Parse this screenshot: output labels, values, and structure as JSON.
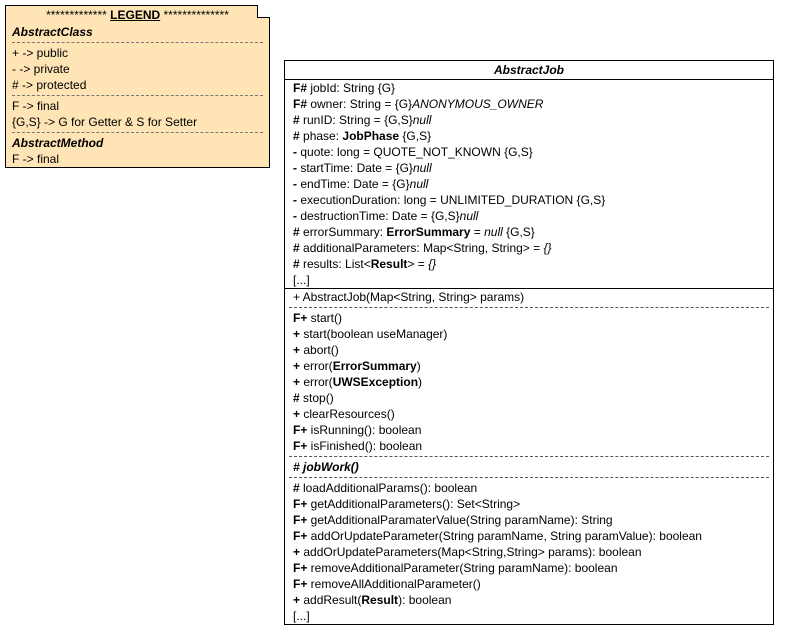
{
  "legend": {
    "title_left_stars": "*************",
    "title_text": "LEGEND",
    "title_right_stars": "**************",
    "abstract_class_label": "AbstractClass",
    "public_line": "+ -> public",
    "private_line": "- -> private",
    "protected_line": "# -> protected",
    "final_line": "F -> final",
    "gs_line": "{G,S} -> G for Getter & S for Setter",
    "abstract_method_label": "AbstractMethod",
    "final2_line": "F -> final"
  },
  "class": {
    "name": "AbstractJob",
    "fields": [
      {
        "pre": "F# ",
        "text": "jobId: String {G}"
      },
      {
        "pre": "F# ",
        "text": "owner: String = ",
        "ital": "ANONYMOUS_OWNER",
        "post": " {G}"
      },
      {
        "pre": "# ",
        "text": "runID: String = ",
        "ital": "null",
        "post": " {G,S}"
      },
      {
        "pre": "# ",
        "text": "phase: ",
        "bold": "JobPhase",
        "post": " {G,S}"
      },
      {
        "pre": "- ",
        "text": "quote: long = QUOTE_NOT_KNOWN {G,S}"
      },
      {
        "pre": "- ",
        "text": "startTime: Date = ",
        "ital": "null",
        "post": " {G}"
      },
      {
        "pre": "- ",
        "text": "endTime: Date = ",
        "ital": "null",
        "post": " {G}"
      },
      {
        "pre": "- ",
        "text": "executionDuration: long = UNLIMITED_DURATION {G,S}"
      },
      {
        "pre": "- ",
        "text": "destructionTime: Date = ",
        "ital": "null",
        "post": " {G,S}"
      },
      {
        "pre": "# ",
        "text": "errorSummary: ",
        "bold": "ErrorSummary",
        "post": " = ",
        "ital2": "null",
        "post2": " {G,S}"
      },
      {
        "pre": "# ",
        "text": "additionalParameters: Map<String, String> = ",
        "ital": "{}"
      },
      {
        "pre": "# ",
        "text": "results: List<",
        "bold": "Result",
        "post": "> = ",
        "ital2": "{}"
      },
      {
        "pre": "",
        "text": "[...]"
      }
    ],
    "constructor": "+ AbstractJob(Map<String, String> params)",
    "methods1": [
      {
        "pre": "F+ ",
        "text": "start()"
      },
      {
        "pre": "+ ",
        "text": "start(boolean useManager)"
      },
      {
        "pre": "+ ",
        "text": "abort()"
      },
      {
        "pre": "+ ",
        "text": "error(",
        "bold": "ErrorSummary",
        "post": ")"
      },
      {
        "pre": "+ ",
        "text": "error(",
        "bold": "UWSException",
        "post": ")"
      },
      {
        "pre": "# ",
        "text": "stop()"
      },
      {
        "pre": "+ ",
        "text": "clearResources()"
      },
      {
        "pre": "F+ ",
        "text": "isRunning(): boolean"
      },
      {
        "pre": "F+ ",
        "text": "isFinished(): boolean"
      }
    ],
    "abstract_method": "# jobWork()",
    "methods2": [
      {
        "pre": "# ",
        "text": "loadAdditionalParams(): boolean"
      },
      {
        "pre": "F+ ",
        "text": "getAdditionalParameters(): Set<String>"
      },
      {
        "pre": "F+ ",
        "text": "getAdditionalParamaterValue(String paramName): String"
      },
      {
        "pre": "F+ ",
        "text": "addOrUpdateParameter(String paramName, String paramValue): boolean"
      },
      {
        "pre": "+ ",
        "text": "addOrUpdateParameters(Map<String,String> params): boolean"
      },
      {
        "pre": "F+ ",
        "text": "removeAdditionalParameter(String paramName): boolean"
      },
      {
        "pre": "F+ ",
        "text": "removeAllAdditionalParameter()"
      },
      {
        "pre": "+ ",
        "text": "addResult(",
        "bold": "Result",
        "post": "): boolean"
      },
      {
        "pre": "",
        "text": "[...]"
      }
    ]
  }
}
